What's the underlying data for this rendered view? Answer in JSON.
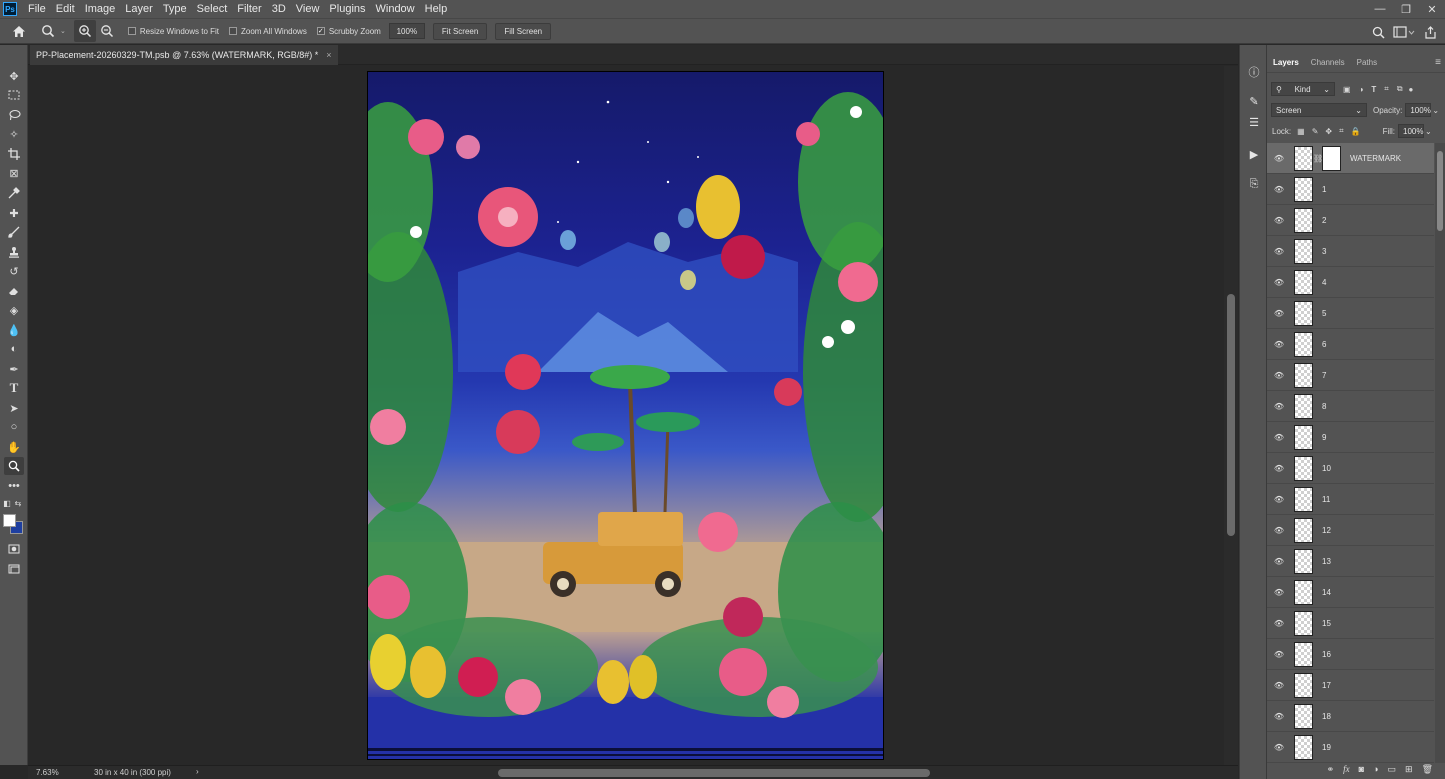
{
  "app": {
    "logo_text": "Ps"
  },
  "menu": [
    "File",
    "Edit",
    "Image",
    "Layer",
    "Type",
    "Select",
    "Filter",
    "3D",
    "View",
    "Plugins",
    "Window",
    "Help"
  ],
  "options": {
    "resize_windows": "Resize Windows to Fit",
    "zoom_all": "Zoom All Windows",
    "scrubby_zoom": "Scrubby Zoom",
    "zoom_value": "100%",
    "fit_screen": "Fit Screen",
    "fill_screen": "Fill Screen"
  },
  "document": {
    "tab_title": "PP-Placement-20260329-TM.psb @ 7.63% (WATERMARK, RGB/8#) *",
    "close_glyph": "×"
  },
  "status": {
    "zoom": "7.63%",
    "doc_info": "30 in x 40 in (300 ppi)",
    "arrow": "›"
  },
  "panel": {
    "tabs": [
      "Layers",
      "Channels",
      "Paths"
    ],
    "filter_kind": "Kind",
    "blend_mode": "Screen",
    "opacity_label": "Opacity:",
    "opacity_value": "100%",
    "lock_label": "Lock:",
    "fill_label": "Fill:",
    "fill_value": "100%"
  },
  "layers": [
    "WATERMARK",
    "1",
    "2",
    "3",
    "4",
    "5",
    "6",
    "7",
    "8",
    "9",
    "10",
    "11",
    "12",
    "13",
    "14",
    "15",
    "16",
    "17",
    "18",
    "19"
  ],
  "colors": {
    "foreground": "#ffffff",
    "background": "#1e3fa0",
    "ui_gray": "#535353",
    "canvas_bg": "#282828"
  }
}
